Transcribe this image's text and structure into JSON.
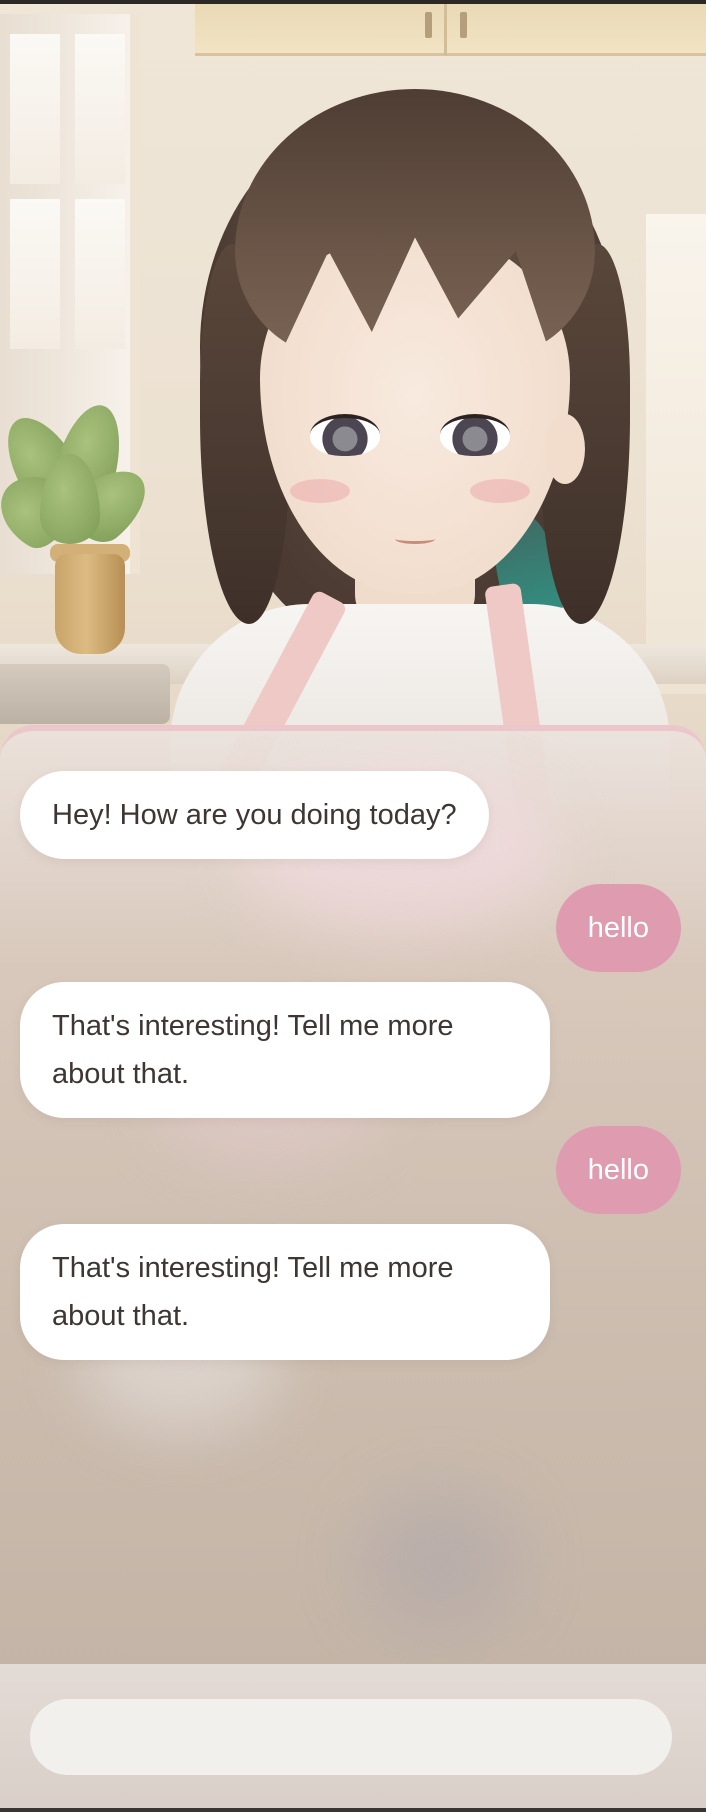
{
  "chat": {
    "messages": [
      {
        "role": "bot",
        "text": "Hey! How are you doing today?"
      },
      {
        "role": "user",
        "text": "hello"
      },
      {
        "role": "bot",
        "text": "That's interesting! Tell me more about that."
      },
      {
        "role": "user",
        "text": "hello"
      },
      {
        "role": "bot",
        "text": "That's interesting! Tell me more about that."
      }
    ]
  },
  "input": {
    "value": "",
    "placeholder": ""
  },
  "colors": {
    "user_bubble": "#df9bb0",
    "bot_bubble": "#ffffff",
    "panel_accent": "#ebc7cc"
  }
}
